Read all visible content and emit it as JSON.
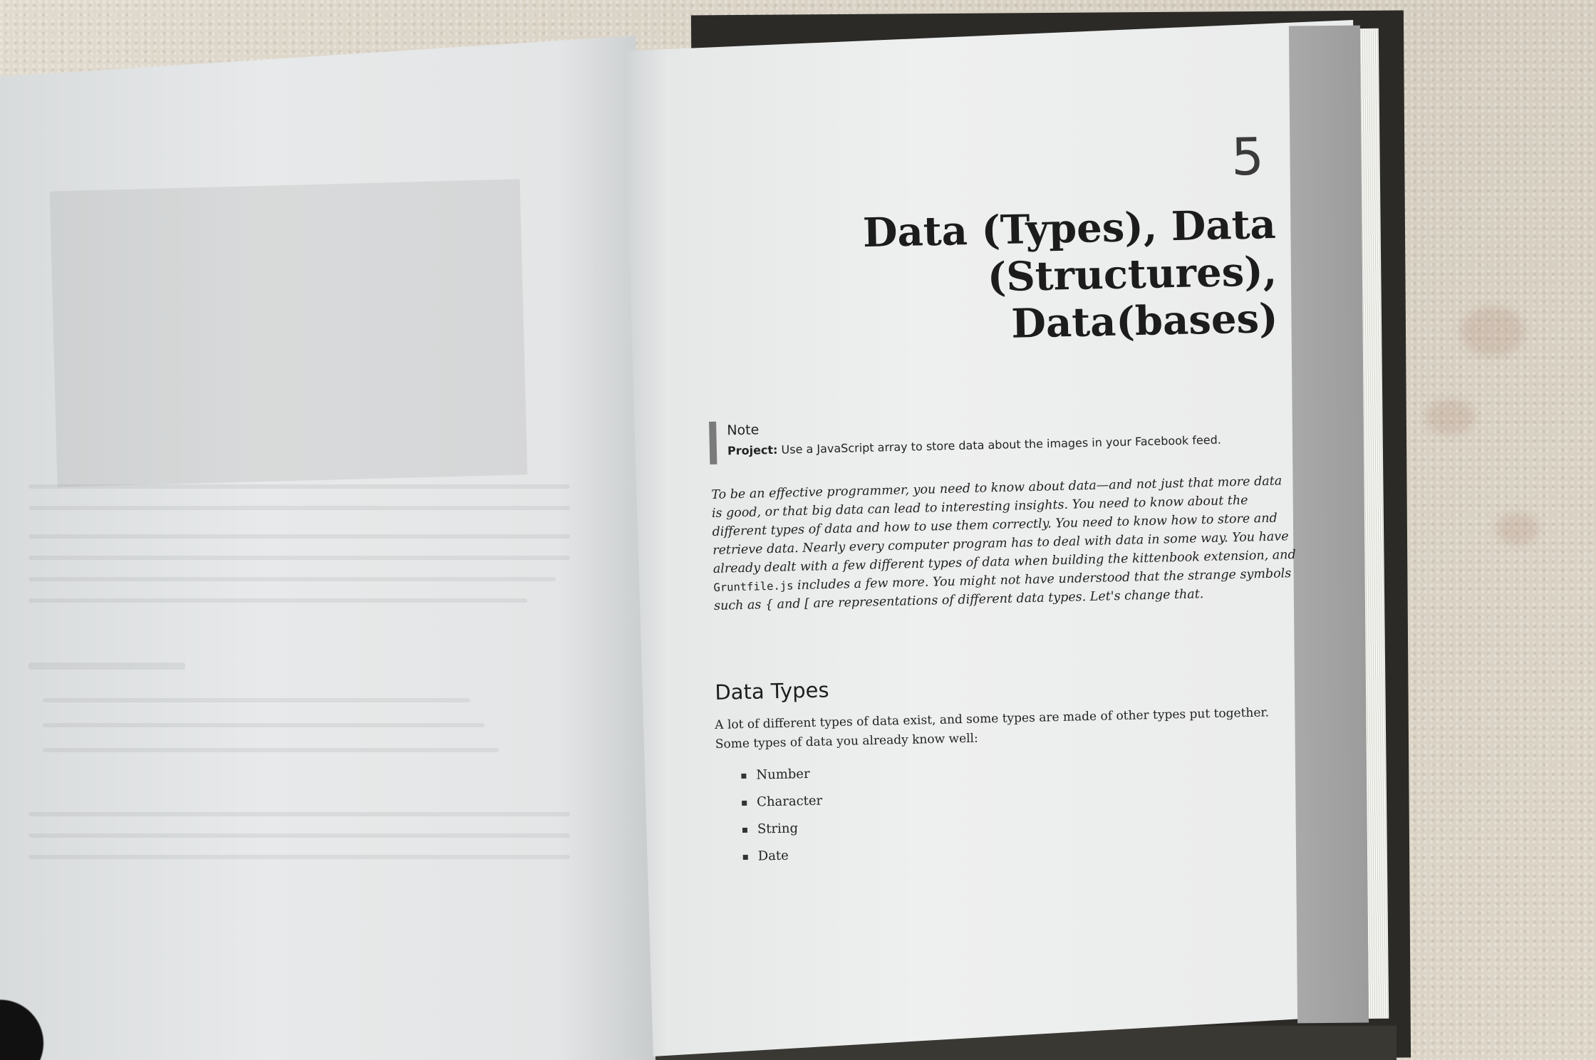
{
  "page_right": {
    "chapter_number": "5",
    "chapter_title_line1": "Data (Types), Data",
    "chapter_title_line2": "(Structures), Data(bases)",
    "note": {
      "heading": "Note",
      "project_label": "Project:",
      "project_text": "Use a JavaScript array to store data about the images in your Facebook feed."
    },
    "intro": {
      "before_code": "To be an effective programmer, you need to know about data—and not just that more data is good, or that big data can lead to interesting insights. You need to know about the different types of data and how to use them correctly. You need to know how to store and retrieve data. Nearly every computer program has to deal with data in some way. You have already dealt with a few different types of data when building the kittenbook extension, and",
      "code": "Gruntfile.js",
      "after_code": "includes a few more. You might not have understood that the strange symbols such as { and [ are representations of different data types. Let's change that."
    },
    "section": {
      "heading": "Data Types",
      "paragraph": "A lot of different types of data exist, and some types are made of other types put together. Some types of data you already know well:",
      "items": [
        "Number",
        "Character",
        "String",
        "Date"
      ]
    }
  },
  "colors": {
    "carpet": "#d9d3c6",
    "page": "#eeefef",
    "chapter_band": "#a0a0a0",
    "text": "#222222"
  }
}
